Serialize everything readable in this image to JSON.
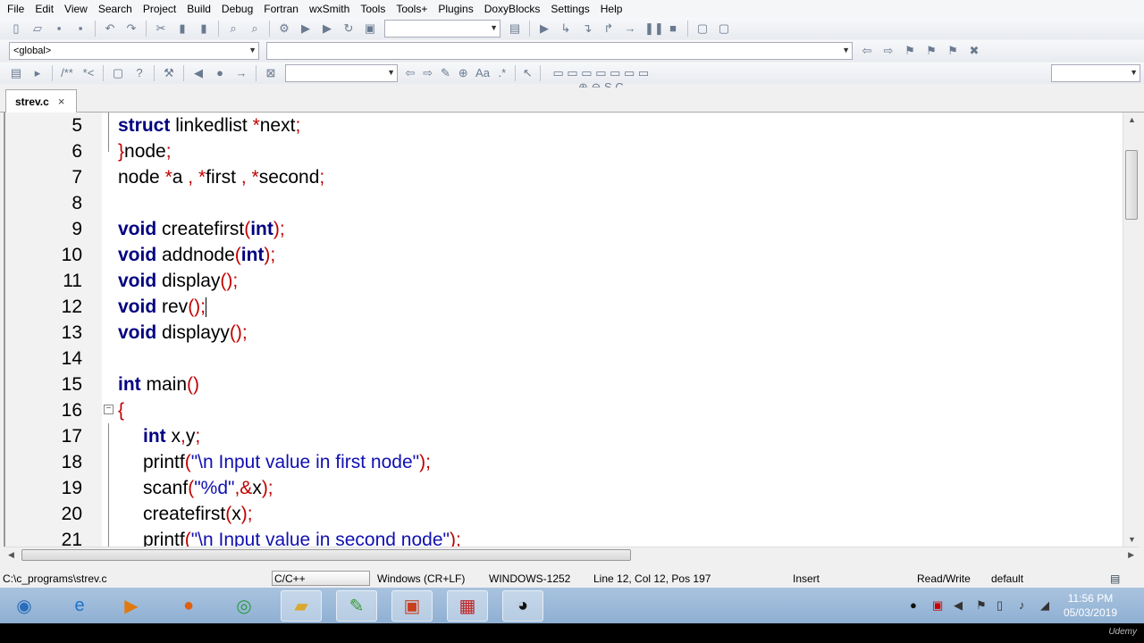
{
  "menu": [
    "File",
    "Edit",
    "View",
    "Search",
    "Project",
    "Build",
    "Debug",
    "Fortran",
    "wxSmith",
    "Tools",
    "Tools+",
    "Plugins",
    "DoxyBlocks",
    "Settings",
    "Help"
  ],
  "toolbar1": [
    "new-file",
    "open",
    "save",
    "save-all",
    "|",
    "undo",
    "redo",
    "|",
    "cut",
    "copy",
    "paste",
    "|",
    "find",
    "replace",
    "|",
    "build-gear",
    "run",
    "build-run",
    "rebuild",
    "abort"
  ],
  "toolbar1b": [
    "debug-target",
    "|",
    "debug-run",
    "step-into",
    "step",
    "step-out",
    "next",
    "break",
    "stop",
    "|",
    "debug-windows",
    "info"
  ],
  "scope": {
    "value": "<global>"
  },
  "toolbar2b": [
    "jump-back",
    "jump-forward",
    "bookmark",
    "prev-bookmark",
    "next-bookmark",
    "clear-bookmarks"
  ],
  "toolbar3": [
    "doxy-wizard",
    "doxy-extract",
    "|",
    "comment-block",
    "comment-line",
    "|",
    "doxy-html",
    "doxy-chm",
    "|",
    "wrench",
    "|",
    "prev",
    "dot",
    "next",
    "|",
    "clear"
  ],
  "toolbar3b": [
    "arrow-left",
    "arrow-right",
    "highlight",
    "select",
    "match-case",
    "regex",
    "|",
    "pointer",
    "|",
    "shapes"
  ],
  "tab": {
    "label": "strev.c",
    "close": "×"
  },
  "code": [
    {
      "n": "5",
      "indent": 0,
      "t": [
        [
          "kw",
          "struct"
        ],
        [
          "",
          "  linkedlist "
        ],
        [
          "op",
          "*"
        ],
        [
          "",
          "next"
        ],
        [
          "op",
          ";"
        ]
      ]
    },
    {
      "n": "6",
      "indent": 0,
      "t": [
        [
          "op",
          "}"
        ],
        [
          "",
          "node"
        ],
        [
          "op",
          ";"
        ]
      ]
    },
    {
      "n": "7",
      "indent": 0,
      "t": [
        [
          "",
          "node "
        ],
        [
          "op",
          "*"
        ],
        [
          "",
          "a "
        ],
        [
          "op",
          ","
        ],
        [
          "",
          "  "
        ],
        [
          "op",
          "*"
        ],
        [
          "",
          "first "
        ],
        [
          "op",
          ","
        ],
        [
          "",
          "  "
        ],
        [
          "op",
          "*"
        ],
        [
          "",
          "second"
        ],
        [
          "op",
          ";"
        ]
      ]
    },
    {
      "n": "8",
      "indent": 0,
      "t": []
    },
    {
      "n": "9",
      "indent": 0,
      "t": [
        [
          "kw",
          "void"
        ],
        [
          "",
          "  createfirst"
        ],
        [
          "op",
          "("
        ],
        [
          "kw",
          "int"
        ],
        [
          "op",
          ");"
        ]
      ]
    },
    {
      "n": "10",
      "indent": 0,
      "t": [
        [
          "kw",
          "void"
        ],
        [
          "",
          "  addnode"
        ],
        [
          "op",
          "("
        ],
        [
          "kw",
          "int"
        ],
        [
          "op",
          ");"
        ]
      ]
    },
    {
      "n": "11",
      "indent": 0,
      "t": [
        [
          "kw",
          "void"
        ],
        [
          "",
          "  display"
        ],
        [
          "op",
          "();"
        ]
      ]
    },
    {
      "n": "12",
      "indent": 0,
      "caret": true,
      "t": [
        [
          "kw",
          "void"
        ],
        [
          "",
          "  rev"
        ],
        [
          "op",
          "();"
        ]
      ]
    },
    {
      "n": "13",
      "indent": 0,
      "t": [
        [
          "kw",
          "void"
        ],
        [
          "",
          "  displayy"
        ],
        [
          "op",
          "();"
        ]
      ]
    },
    {
      "n": "14",
      "indent": 0,
      "t": []
    },
    {
      "n": "15",
      "indent": 0,
      "t": [
        [
          "kw",
          "int"
        ],
        [
          "",
          "  main"
        ],
        [
          "op",
          "()"
        ]
      ]
    },
    {
      "n": "16",
      "indent": 0,
      "fold": true,
      "t": [
        [
          "op",
          "{"
        ]
      ]
    },
    {
      "n": "17",
      "indent": 1,
      "t": [
        [
          "kw",
          "int"
        ],
        [
          "",
          "  x"
        ],
        [
          "op",
          ","
        ],
        [
          "",
          "y"
        ],
        [
          "op",
          ";"
        ]
      ]
    },
    {
      "n": "18",
      "indent": 1,
      "t": [
        [
          "",
          "printf"
        ],
        [
          "op",
          "("
        ],
        [
          "str",
          "\"\\n Input value in first node\""
        ],
        [
          "op",
          ");"
        ]
      ]
    },
    {
      "n": "19",
      "indent": 1,
      "t": [
        [
          "",
          "scanf"
        ],
        [
          "op",
          "("
        ],
        [
          "str",
          "\"%d\""
        ],
        [
          "op",
          ",&"
        ],
        [
          "",
          "x"
        ],
        [
          "op",
          ");"
        ]
      ]
    },
    {
      "n": "20",
      "indent": 1,
      "t": [
        [
          "",
          "createfirst"
        ],
        [
          "op",
          "("
        ],
        [
          "",
          "x"
        ],
        [
          "op",
          ");"
        ]
      ]
    },
    {
      "n": "21",
      "indent": 1,
      "t": [
        [
          "",
          "printf"
        ],
        [
          "op",
          "("
        ],
        [
          "str",
          "\"\\n Input value in second node\""
        ],
        [
          "op",
          ");"
        ]
      ]
    }
  ],
  "status": {
    "path": "C:\\c_programs\\strev.c",
    "lang": "C/C++",
    "eol": "Windows (CR+LF)",
    "encoding": "WINDOWS-1252",
    "position": "Line 12, Col 12, Pos 197",
    "mode": "Insert",
    "access": "Read/Write",
    "profile": "default"
  },
  "clock": {
    "time": "11:56 PM",
    "date": "05/03/2019"
  },
  "watermark": "Udemy",
  "colors": {
    "keyword": "#000080",
    "operator": "#c00000",
    "string": "#1010b0"
  }
}
